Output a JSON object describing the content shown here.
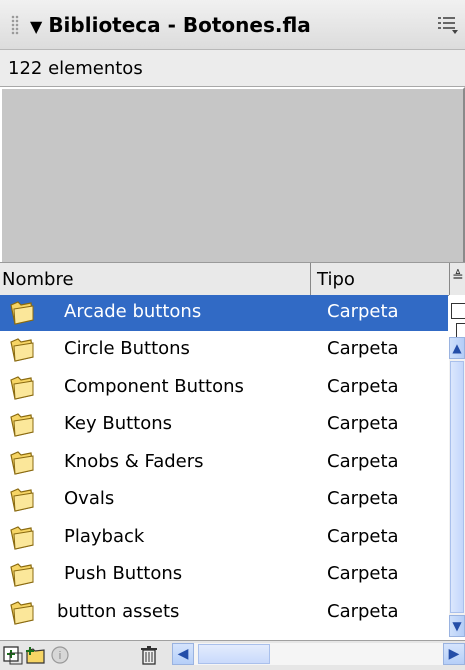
{
  "panel": {
    "title": "Biblioteca - Botones.fla",
    "item_count": "122 elementos"
  },
  "columns": {
    "name": "Nombre",
    "type": "Tipo"
  },
  "items": [
    {
      "name": "Arcade buttons",
      "type": "Carpeta",
      "selected": true
    },
    {
      "name": "Circle Buttons",
      "type": "Carpeta"
    },
    {
      "name": "Component Buttons",
      "type": "Carpeta"
    },
    {
      "name": "Key Buttons",
      "type": "Carpeta"
    },
    {
      "name": "Knobs & Faders",
      "type": "Carpeta"
    },
    {
      "name": "Ovals",
      "type": "Carpeta"
    },
    {
      "name": "Playback",
      "type": "Carpeta"
    },
    {
      "name": "Push Buttons",
      "type": "Carpeta"
    },
    {
      "name": "button assets",
      "type": "Carpeta"
    }
  ],
  "icons": {
    "collapse": "triangle-down-icon",
    "options": "panel-menu-icon",
    "row": "folder-icon",
    "sort": "sort-order-icon"
  },
  "colors": {
    "selection": "#316ac5",
    "preview_bg": "#c6c6c6"
  }
}
